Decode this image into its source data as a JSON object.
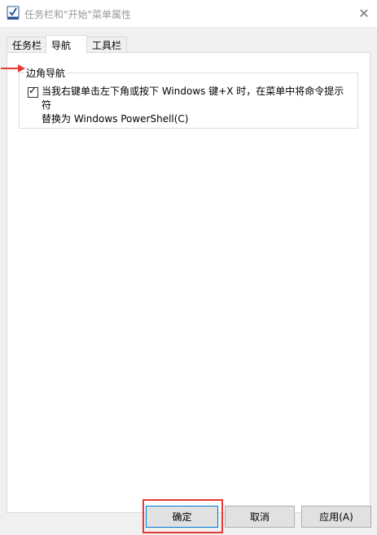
{
  "window": {
    "title": "任务栏和\"开始\"菜单属性",
    "close_glyph": "✕"
  },
  "tabs": [
    {
      "label": "任务栏",
      "active": false
    },
    {
      "label": "导航",
      "active": true
    },
    {
      "label": "工具栏",
      "active": false
    }
  ],
  "navigation": {
    "group_title": "边角导航",
    "replace_cmd_checkbox": {
      "checked": true,
      "check_glyph": "✓",
      "label_line1": "当我右键单击左下角或按下 Windows 键+X 时，在菜单中将命令提示符",
      "label_line2": "替换为 Windows PowerShell(C)"
    }
  },
  "buttons": {
    "ok": "确定",
    "cancel": "取消",
    "apply": "应用(A)"
  },
  "annotation_color": "#e53935"
}
